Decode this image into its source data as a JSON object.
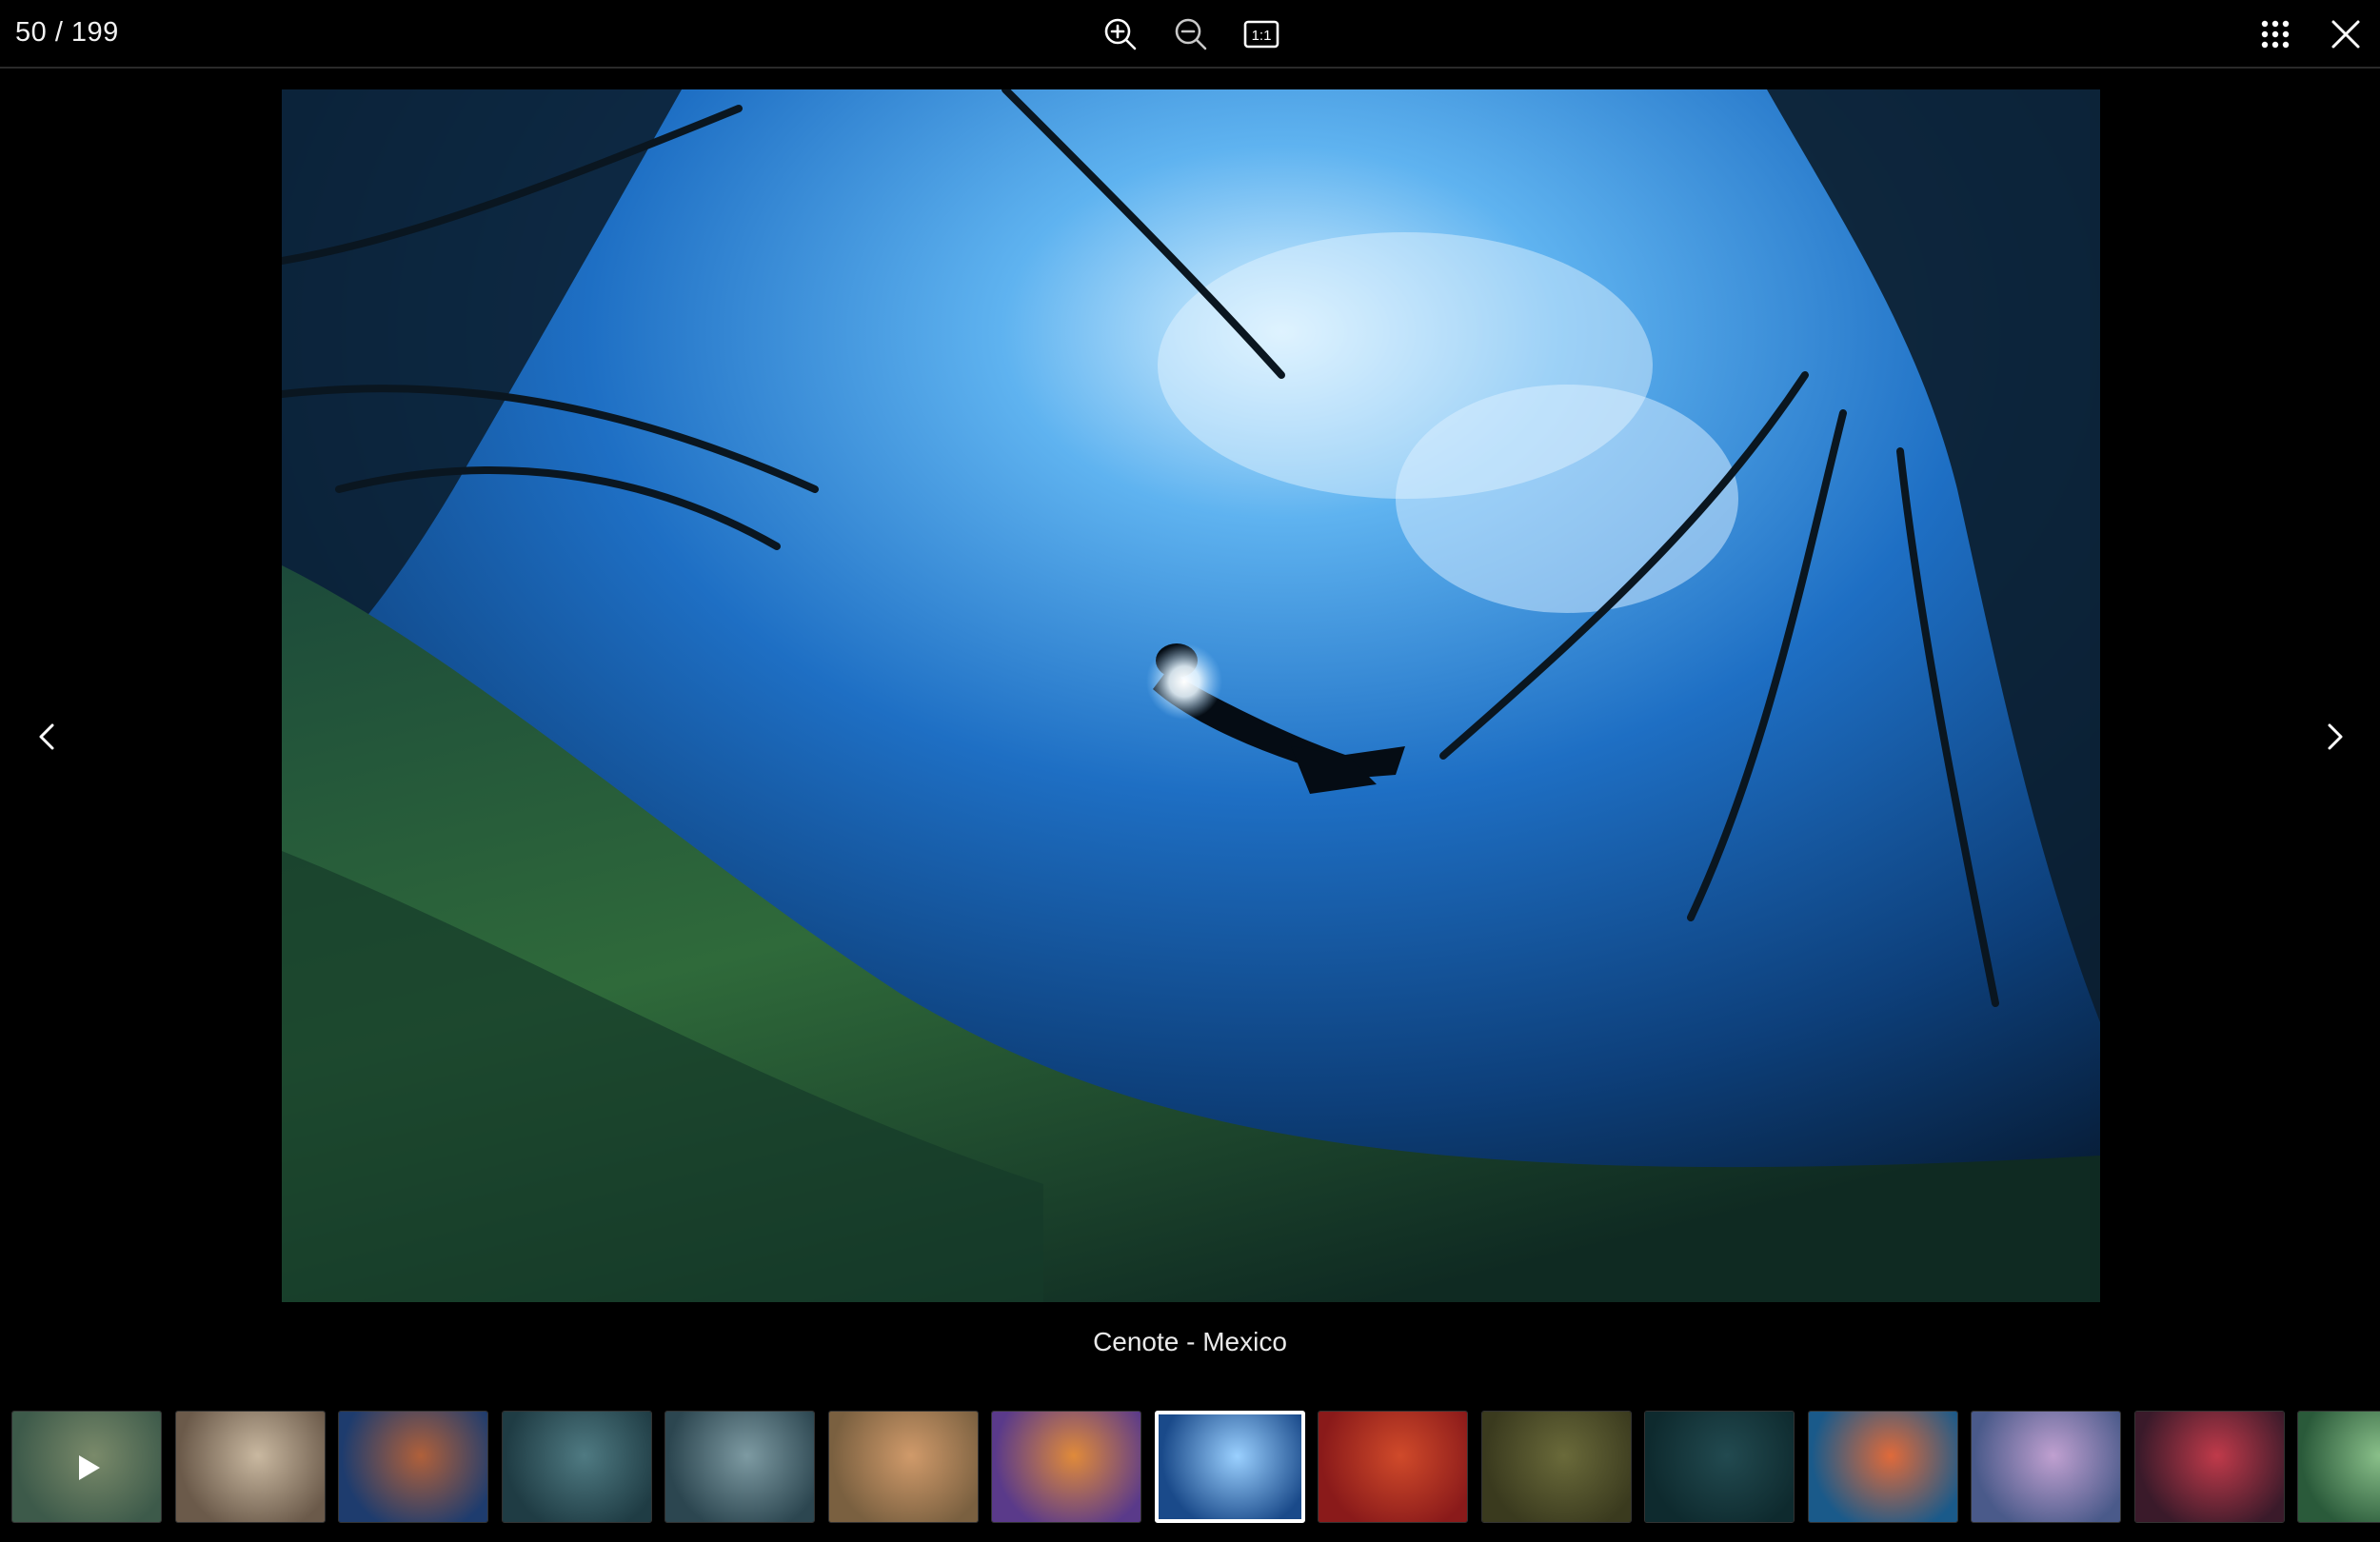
{
  "counter": {
    "current": 50,
    "total": 199,
    "text": "50 / 199"
  },
  "toolbar": [
    {
      "name": "zoom-in",
      "icon": "zoom-in-icon"
    },
    {
      "name": "zoom-out",
      "icon": "zoom-out-icon"
    },
    {
      "name": "actual-size",
      "icon": "actual-size-icon",
      "label": "1:1"
    }
  ],
  "top_right": [
    {
      "name": "grid-view",
      "icon": "grid-icon"
    },
    {
      "name": "close",
      "icon": "close-icon"
    }
  ],
  "viewer": {
    "caption": "Cenote - Mexico",
    "prev_icon": "chevron-left-icon",
    "next_icon": "chevron-right-icon"
  },
  "thumbnails": [
    {
      "icon": "play-icon",
      "colors": [
        "#3d5a4a",
        "#7a8a6a"
      ]
    },
    {
      "colors": [
        "#6b5a4a",
        "#c9b8a0"
      ]
    },
    {
      "colors": [
        "#1e3c6e",
        "#b0603a"
      ]
    },
    {
      "colors": [
        "#1f3c44",
        "#4f7a82"
      ]
    },
    {
      "colors": [
        "#2c4650",
        "#7d9aa2"
      ]
    },
    {
      "colors": [
        "#7a6040",
        "#d09a6a"
      ]
    },
    {
      "colors": [
        "#5a3a8a",
        "#e08a3a"
      ]
    },
    {
      "colors": [
        "#1a4a8a",
        "#9ad0ff"
      ],
      "active": true
    },
    {
      "colors": [
        "#8a1a1a",
        "#d04a2a"
      ]
    },
    {
      "colors": [
        "#3a3a1e",
        "#6a6a3a"
      ]
    },
    {
      "colors": [
        "#0e2a2e",
        "#224a50"
      ]
    },
    {
      "colors": [
        "#1a5a8a",
        "#e06a3a"
      ]
    },
    {
      "colors": [
        "#4a5a8a",
        "#c0a0d0"
      ]
    },
    {
      "colors": [
        "#3a1a2a",
        "#c03a4a"
      ]
    },
    {
      "colors": [
        "#2a5a3a",
        "#8ac08a"
      ]
    }
  ]
}
